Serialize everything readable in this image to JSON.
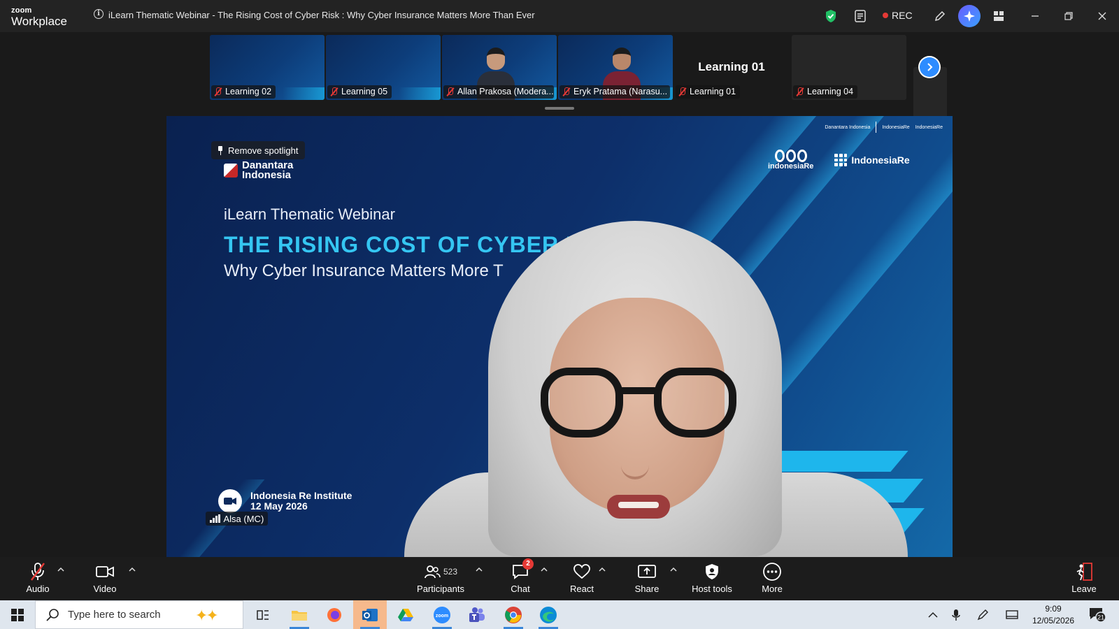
{
  "app": {
    "brand_top": "zoom",
    "brand_bottom": "Workplace"
  },
  "window": {
    "title": "iLearn Thematic Webinar - The Rising Cost of Cyber Risk : Why Cyber Insurance Matters More Than Ever"
  },
  "recording": {
    "label": "REC"
  },
  "thumbnails": [
    {
      "name": "Learning 02",
      "kind": "slide-mirrored"
    },
    {
      "name": "Learning 05",
      "kind": "slide"
    },
    {
      "name": "Allan Prakosa (Modera...",
      "kind": "person"
    },
    {
      "name": "Eryk Pratama (Narasu...",
      "kind": "person"
    },
    {
      "name": "Learning 01",
      "center_label": "Learning 01",
      "kind": "no-video"
    },
    {
      "name": "Learning 04",
      "kind": "no-video"
    }
  ],
  "spotlight": {
    "remove_label": "Remove spotlight",
    "speaker_name": "Alsa (MC)"
  },
  "slide": {
    "org_logo": "Danantara Indonesia",
    "org_logo_l1": "Danantara",
    "org_logo_l2": "Indonesia",
    "subtitle": "iLearn Thematic Webinar",
    "title": "THE RISING COST OF CYBER R",
    "tagline": "Why Cyber Insurance Matters More T",
    "partner_logo_1": "indonesiaRe",
    "partner_logo_2": "IndonesiaRe",
    "institute": "Indonesia Re Institute",
    "date": "12 May 2026",
    "top_logo_1": "Danantara Indonesia",
    "top_logo_2": "IndonesiaRe",
    "top_logo_3": "IndonesiaRe"
  },
  "toolbar": {
    "audio": "Audio",
    "video": "Video",
    "participants": "Participants",
    "participants_count": "523",
    "chat": "Chat",
    "chat_badge": "2",
    "react": "React",
    "share": "Share",
    "host_tools": "Host tools",
    "more": "More",
    "leave": "Leave"
  },
  "taskbar": {
    "search_placeholder": "Type here to search",
    "time": "9:09",
    "date": "12/05/2026",
    "notifications": "21"
  }
}
